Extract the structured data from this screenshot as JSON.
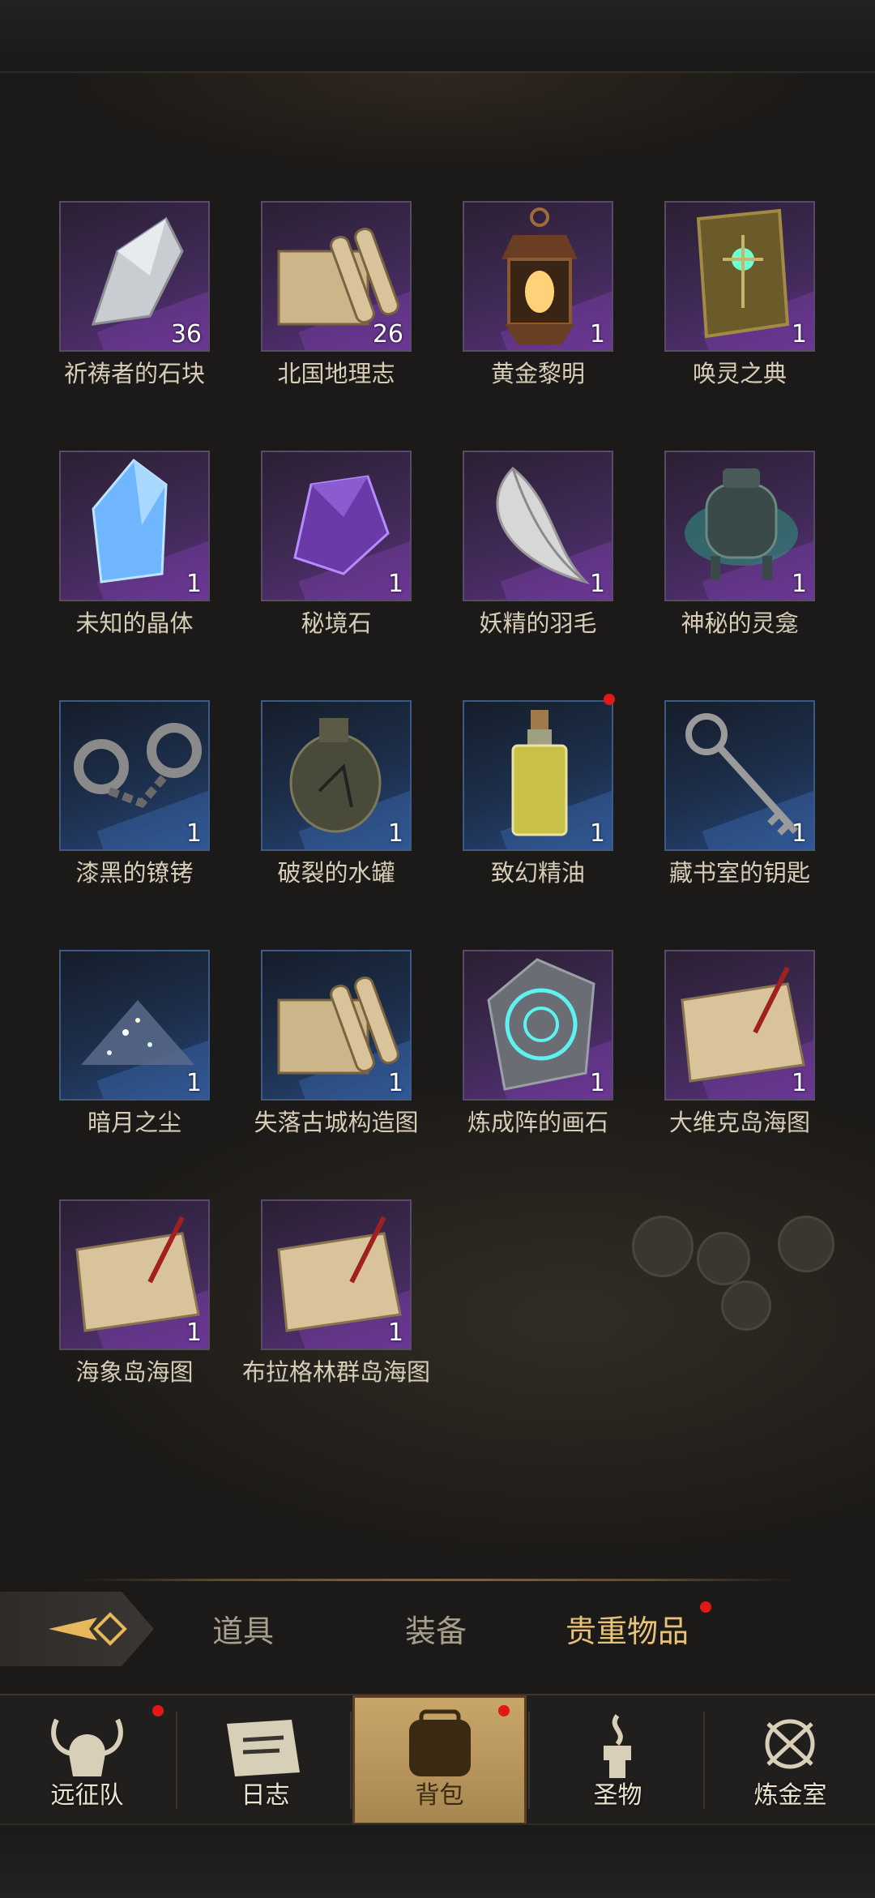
{
  "items": [
    {
      "name": "祈祷者的石块",
      "count": "36",
      "icon": "stone-icon",
      "rarity": "purple"
    },
    {
      "name": "北国地理志",
      "count": "26",
      "icon": "scroll-icon",
      "rarity": "purple"
    },
    {
      "name": "黄金黎明",
      "count": "1",
      "icon": "lantern-icon",
      "rarity": "purple"
    },
    {
      "name": "唤灵之典",
      "count": "1",
      "icon": "tome-icon",
      "rarity": "purple"
    },
    {
      "name": "未知的晶体",
      "count": "1",
      "icon": "crystal-icon",
      "rarity": "purple"
    },
    {
      "name": "秘境石",
      "count": "1",
      "icon": "amethyst-icon",
      "rarity": "purple"
    },
    {
      "name": "妖精的羽毛",
      "count": "1",
      "icon": "feather-icon",
      "rarity": "purple"
    },
    {
      "name": "神秘的灵龛",
      "count": "1",
      "icon": "urn-icon",
      "rarity": "purple"
    },
    {
      "name": "漆黑的镣铐",
      "count": "1",
      "icon": "shackles-icon",
      "rarity": "blue"
    },
    {
      "name": "破裂的水罐",
      "count": "1",
      "icon": "jug-icon",
      "rarity": "blue"
    },
    {
      "name": "致幻精油",
      "count": "1",
      "icon": "oil-bottle-icon",
      "rarity": "blue",
      "new": true
    },
    {
      "name": "藏书室的钥匙",
      "count": "1",
      "icon": "key-icon",
      "rarity": "blue"
    },
    {
      "name": "暗月之尘",
      "count": "1",
      "icon": "dust-icon",
      "rarity": "blue"
    },
    {
      "name": "失落古城构造图",
      "count": "1",
      "icon": "scroll-icon",
      "rarity": "blue"
    },
    {
      "name": "炼成阵的画石",
      "count": "1",
      "icon": "rune-stone-icon",
      "rarity": "purple"
    },
    {
      "name": "大维克岛海图",
      "count": "1",
      "icon": "sea-chart-icon",
      "rarity": "purple"
    },
    {
      "name": "海象岛海图",
      "count": "1",
      "icon": "sea-chart-icon",
      "rarity": "purple"
    },
    {
      "name": "布拉格林群岛海图",
      "count": "1",
      "icon": "sea-chart-icon",
      "rarity": "purple"
    }
  ],
  "tabs": [
    {
      "label": "道具",
      "active": false
    },
    {
      "label": "装备",
      "active": false
    },
    {
      "label": "贵重物品",
      "active": true,
      "badge": true
    }
  ],
  "nav": [
    {
      "label": "远征队",
      "icon": "viking-helmet-icon",
      "badge": true
    },
    {
      "label": "日志",
      "icon": "journal-icon"
    },
    {
      "label": "背包",
      "icon": "backpack-icon",
      "active": true,
      "badge": true
    },
    {
      "label": "圣物",
      "icon": "relic-icon"
    },
    {
      "label": "炼金室",
      "icon": "alchemy-icon"
    }
  ],
  "colors": {
    "purple": "#5a2f7e",
    "blue": "#27477a",
    "accent": "#e7c37a",
    "badge": "#e01818"
  }
}
